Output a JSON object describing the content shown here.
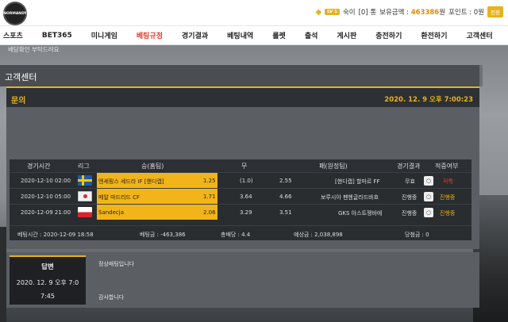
{
  "header": {
    "logo_text": "NORMANDY",
    "level_badge": "LV 1",
    "username": "숙이",
    "messages": "[0] 통",
    "balance_label": "보유금액 :",
    "balance_value": "463386",
    "balance_unit": "원",
    "points_label": "포인트 : 0원",
    "convert_label": "전환"
  },
  "nav": {
    "items": [
      "스포츠",
      "BET365",
      "미니게임",
      "베팅규정",
      "경기결과",
      "베팅내역",
      "룰렛",
      "출석",
      "게시판",
      "충전하기",
      "환전하기",
      "고객센터"
    ],
    "active": "베팅규정"
  },
  "page": {
    "title": "고객센터"
  },
  "inquiry": {
    "title": "문의",
    "date": "2020. 12. 9 오후 7:00:23",
    "body": "배당확인 부탁드려요"
  },
  "bet_table": {
    "headers": [
      "경기시간",
      "리그",
      "승(홈팀)",
      "무",
      "패(원정팀)",
      "경기결과",
      "적중여부"
    ],
    "rows": [
      {
        "time": "2020-12-10 02:00",
        "home": "엔세핑스 세드라 IF [핸디캡]",
        "home_odds": "1.25",
        "draw": "(1.0)",
        "away_odds": "2.55",
        "away": "[핸디캡] 할마르 FF",
        "result": "무효",
        "status": "적특"
      },
      {
        "time": "2020-12-10 05:00",
        "home": "메알 마드리드 CF",
        "home_odds": "1.71",
        "draw": "3.64",
        "away_odds": "4.66",
        "away": "보루시아 펜헨글라드바흐",
        "result": "진행중",
        "status": "진행중"
      },
      {
        "time": "2020-12-09 21:00",
        "home": "Sandecja",
        "home_odds": "2.06",
        "draw": "3.29",
        "away_odds": "3.51",
        "away": "GKS 아스트쟁바에",
        "result": "진행중",
        "status": "진행중"
      }
    ],
    "summary": {
      "bet_time": "베팅시간 : 2020-12-09 18:58",
      "bet_amount": "베팅금 : -463,386",
      "total_odds": "총배당 : 4.4",
      "expected": "예상금 : 2,038,898",
      "win_amount": "당첨금 : 0"
    }
  },
  "answer": {
    "label": "답변",
    "date": "2020. 12. 9 오후 7:0",
    "time": "7:45",
    "line1": "정상배팅입니다",
    "line2": "감사합니다"
  },
  "colors": {
    "accent": "#e7b21c",
    "active_nav": "#e33b2d"
  }
}
